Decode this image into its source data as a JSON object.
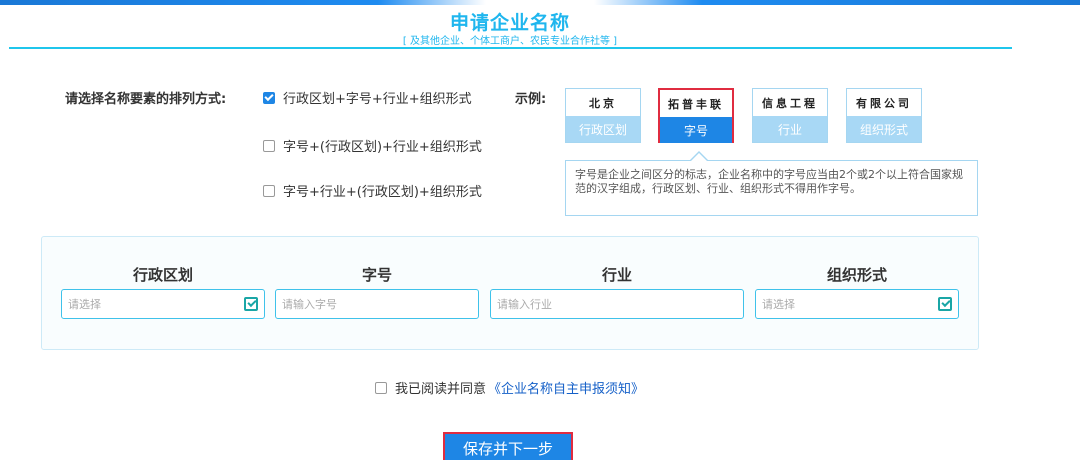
{
  "header": {
    "title": "申请企业名称",
    "subtitle": "[ 及其他企业、个体工商户、农民专业合作社等 ]"
  },
  "arrangement": {
    "label": "请选择名称要素的排列方式:",
    "options": [
      {
        "label": "行政区划+字号+行业+组织形式",
        "checked": true
      },
      {
        "label": "字号+(行政区划)+行业+组织形式",
        "checked": false
      },
      {
        "label": "字号+行业+(行政区划)+组织形式",
        "checked": false
      }
    ]
  },
  "example": {
    "label": "示例:",
    "items": [
      {
        "sample": "北京",
        "caption": "行政区划",
        "active": false
      },
      {
        "sample": "拓普丰联",
        "caption": "字号",
        "active": true
      },
      {
        "sample": "信息工程",
        "caption": "行业",
        "active": false
      },
      {
        "sample": "有限公司",
        "caption": "组织形式",
        "active": false
      }
    ],
    "tip": "字号是企业之间区分的标志，企业名称中的字号应当由2个或2个以上符合国家规范的汉字组成，行政区划、行业、组织形式不得用作字号。"
  },
  "form": {
    "columns": [
      {
        "header": "行政区划",
        "placeholder": "请选择",
        "has_select_icon": true
      },
      {
        "header": "字号",
        "placeholder": "请输入字号",
        "has_select_icon": false
      },
      {
        "header": "行业",
        "placeholder": "请输入行业",
        "has_select_icon": false
      },
      {
        "header": "组织形式",
        "placeholder": "请选择",
        "has_select_icon": true
      }
    ]
  },
  "agreement": {
    "text": "我已阅读并同意",
    "link": "《企业名称自主申报须知》",
    "checked": false
  },
  "actions": {
    "save_label": "保存并下一步"
  },
  "colors": {
    "accent": "#1fb6ee",
    "primary_button": "#1e86e5",
    "highlight_border": "#e02c40"
  }
}
